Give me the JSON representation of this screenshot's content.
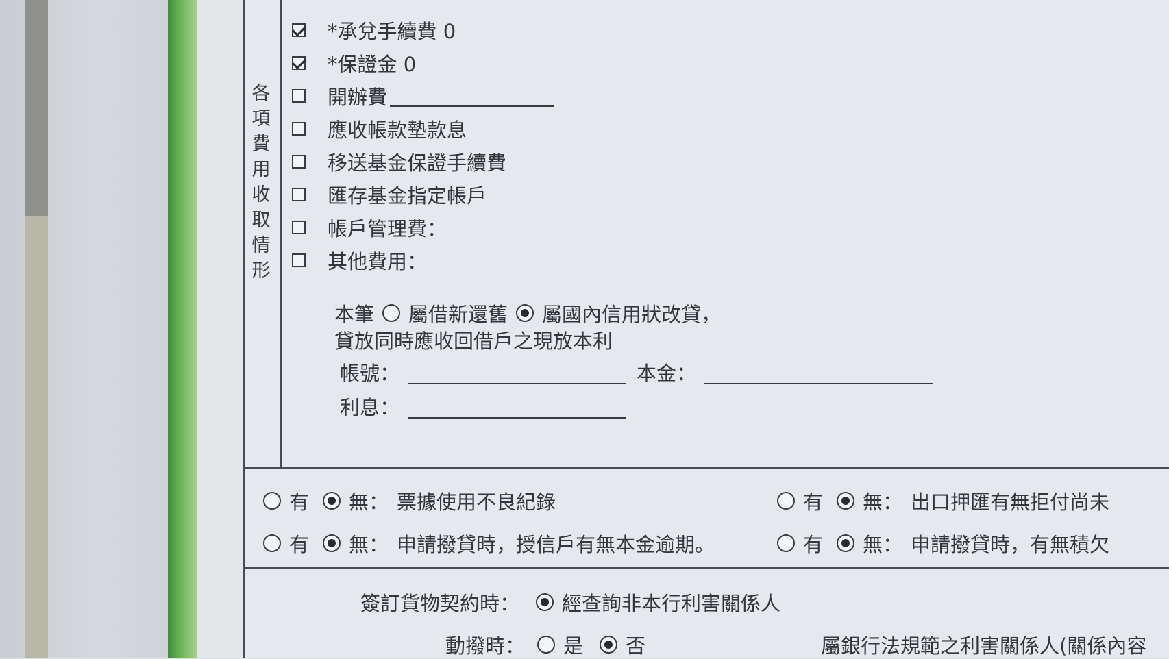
{
  "section_title": "各項費用收取情形",
  "fees": [
    {
      "label": "*承兌手續費 0",
      "checked": true
    },
    {
      "label": "*保證金 0",
      "checked": true
    },
    {
      "label": "開辦費",
      "checked": false
    },
    {
      "label": "應收帳款墊款息",
      "checked": false
    },
    {
      "label": "移送基金保證手續費",
      "checked": false
    },
    {
      "label": "匯存基金指定帳戶",
      "checked": false
    },
    {
      "label": "帳戶管理費：",
      "checked": false
    },
    {
      "label": "其他費用：",
      "checked": false
    }
  ],
  "loan": {
    "prefix": "本筆",
    "option1": "屬借新還舊",
    "option2": "屬國內信用狀改貸，",
    "selected": "option2",
    "desc": "貸放同時應收回借戶之現放本利",
    "account_label": "帳號：",
    "principal_label": "本金：",
    "interest_label": "利息："
  },
  "checks": {
    "yes": "有",
    "no": "無：",
    "row1_left": "票據使用不良紀錄",
    "row1_right": "出口押匯有無拒付尚未",
    "row2_left": "申請撥貸時，授信戶有無本金逾期。",
    "row2_right": "申請撥貸時，有無積欠"
  },
  "relation": {
    "contract_label": "簽訂貨物契約時：",
    "contract_option": "經查詢非本行利害關係人",
    "draw_label": "動撥時：",
    "draw_yes": "是",
    "draw_no": "否",
    "draw_selected": "no",
    "law_note": "屬銀行法規範之利害關係人(關係內容"
  }
}
